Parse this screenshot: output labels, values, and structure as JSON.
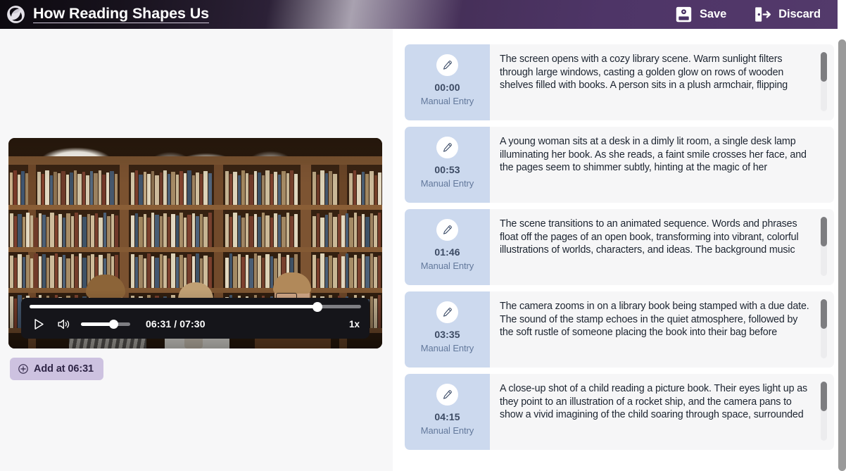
{
  "header": {
    "logo_icon": "spiral-logo-icon",
    "title": "How Reading Shapes Us",
    "save_label": "Save",
    "save_icon": "floppy-disk-save-icon",
    "discard_label": "Discard",
    "discard_icon": "exit-door-discard-icon",
    "accent_dark": "#0d0a10",
    "accent_purple": "#533a6b"
  },
  "player": {
    "current_time": "06:31",
    "duration": "07:30",
    "time_display": "06:31 / 07:30",
    "progress_percent": 86.9,
    "volume_percent": 66,
    "speed": "1x",
    "play_icon": "play-icon",
    "volume_icon": "volume-on-icon",
    "state": "paused",
    "scene_description": "Library interior with three people seated in front of tall wooden bookshelves"
  },
  "add_entry": {
    "label": "Add at 06:31",
    "icon": "plus-circle-icon",
    "background": "#cdc2e0"
  },
  "entries": {
    "meta_background": "#ccd9ee",
    "card_background": "#f6f6f7",
    "edit_icon": "pencil-edit-icon",
    "items": [
      {
        "time": "00:00",
        "kind": "Manual Entry",
        "text": "The screen opens with a cozy library scene. Warm sunlight filters through large windows, casting a golden glow on rows of wooden shelves filled with books. A person sits in a plush armchair, flipping",
        "has_scrollbar": true,
        "scroll_thumb_percent": 50
      },
      {
        "time": "00:53",
        "kind": "Manual Entry",
        "text": "A young woman sits at a desk in a dimly lit room, a single desk lamp illuminating her book. As she reads, a faint smile crosses her face, and the pages seem to shimmer subtly, hinting at the magic of her imagination.",
        "has_scrollbar": false,
        "scroll_thumb_percent": 0
      },
      {
        "time": "01:46",
        "kind": "Manual Entry",
        "text": "The scene transitions to an animated sequence. Words and phrases float off the pages of an open book, transforming into vibrant, colorful illustrations of worlds, characters, and ideas. The background music",
        "has_scrollbar": true,
        "scroll_thumb_percent": 50
      },
      {
        "time": "03:35",
        "kind": "Manual Entry",
        "text": "The camera zooms in on a library book being stamped with a due date. The sound of the stamp echoes in the quiet atmosphere, followed by the soft rustle of someone placing the book into their bag before",
        "has_scrollbar": true,
        "scroll_thumb_percent": 50
      },
      {
        "time": "04:15",
        "kind": "Manual Entry",
        "text": "A close-up shot of a child reading a picture book. Their eyes light up as they point to an illustration of a rocket ship, and the camera pans to show a vivid imagining of the child soaring through space, surrounded",
        "has_scrollbar": true,
        "scroll_thumb_percent": 50
      }
    ]
  }
}
